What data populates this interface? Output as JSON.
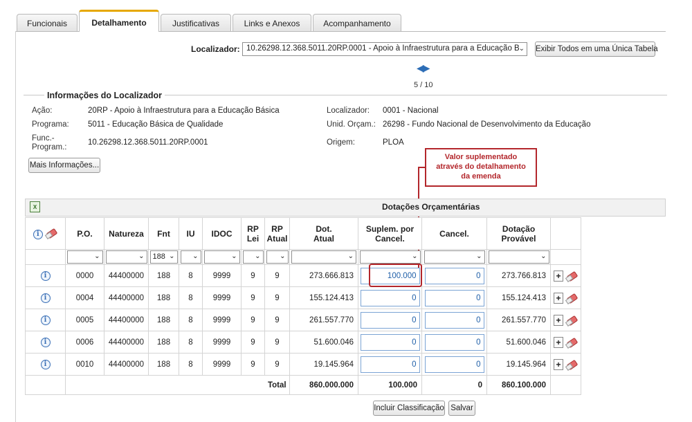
{
  "tabs": [
    "Funcionais",
    "Detalhamento",
    "Justificativas",
    "Links e Anexos",
    "Acompanhamento"
  ],
  "localizador": {
    "label": "Localizador:",
    "value": "10.26298.12.368.5011.20RP.0001 - Apoio à Infraestrutura para a Educação B",
    "show_all_button": "Exibir Todos em uma Única Tabela",
    "pager": "5 / 10"
  },
  "info": {
    "legend": "Informações do Localizador",
    "acao_label": "Ação:",
    "acao_value": "20RP - Apoio à Infraestrutura para a Educação Básica",
    "programa_label": "Programa:",
    "programa_value": "5011 - Educação Básica de Qualidade",
    "func_label_1": "Func.-",
    "func_label_2": "Program.:",
    "func_value": "10.26298.12.368.5011.20RP.0001",
    "localizador_label": "Localizador:",
    "localizador_value": "0001 - Nacional",
    "unid_label": "Unid. Orçam.:",
    "unid_value": "26298 - Fundo Nacional de Desenvolvimento da Educação",
    "origem_label": "Origem:",
    "origem_value": "PLOA",
    "more_button": "Mais Informações..."
  },
  "callout": [
    "Valor suplementado",
    "através do detalhamento",
    "da emenda"
  ],
  "grid": {
    "title": "Dotações Orçamentárias",
    "headers": {
      "po": "P.O.",
      "natureza": "Natureza",
      "fnt": "Fnt",
      "iu": "IU",
      "idoc": "IDOC",
      "rplei_1": "RP",
      "rplei_2": "Lei",
      "rpatual_1": "RP",
      "rpatual_2": "Atual",
      "dotatual_1": "Dot.",
      "dotatual_2": "Atual",
      "suplem_1": "Suplem. por",
      "suplem_2": "Cancel.",
      "cancel": "Cancel.",
      "dotprov_1": "Dotação",
      "dotprov_2": "Provável"
    },
    "fnt_filter": "188",
    "rows": [
      {
        "po": "0000",
        "natureza": "44400000",
        "fnt": "188",
        "iu": "8",
        "idoc": "9999",
        "rplei": "9",
        "rpatual": "9",
        "dot_atual": "273.666.813",
        "suplem": "100.000",
        "cancel": "0",
        "dot_provavel": "273.766.813"
      },
      {
        "po": "0004",
        "natureza": "44400000",
        "fnt": "188",
        "iu": "8",
        "idoc": "9999",
        "rplei": "9",
        "rpatual": "9",
        "dot_atual": "155.124.413",
        "suplem": "0",
        "cancel": "0",
        "dot_provavel": "155.124.413"
      },
      {
        "po": "0005",
        "natureza": "44400000",
        "fnt": "188",
        "iu": "8",
        "idoc": "9999",
        "rplei": "9",
        "rpatual": "9",
        "dot_atual": "261.557.770",
        "suplem": "0",
        "cancel": "0",
        "dot_provavel": "261.557.770"
      },
      {
        "po": "0006",
        "natureza": "44400000",
        "fnt": "188",
        "iu": "8",
        "idoc": "9999",
        "rplei": "9",
        "rpatual": "9",
        "dot_atual": "51.600.046",
        "suplem": "0",
        "cancel": "0",
        "dot_provavel": "51.600.046"
      },
      {
        "po": "0010",
        "natureza": "44400000",
        "fnt": "188",
        "iu": "8",
        "idoc": "9999",
        "rplei": "9",
        "rpatual": "9",
        "dot_atual": "19.145.964",
        "suplem": "0",
        "cancel": "0",
        "dot_provavel": "19.145.964"
      }
    ],
    "total": {
      "label": "Total",
      "dot_atual": "860.000.000",
      "suplem": "100.000",
      "cancel": "0",
      "dot_provavel": "860.100.000"
    }
  },
  "buttons": {
    "incluir": "Incluir Classificação",
    "salvar": "Salvar"
  },
  "colors": {
    "accent_tab": "#e6a800",
    "callout": "#b3262b",
    "link_blue": "#1f5fa8"
  }
}
